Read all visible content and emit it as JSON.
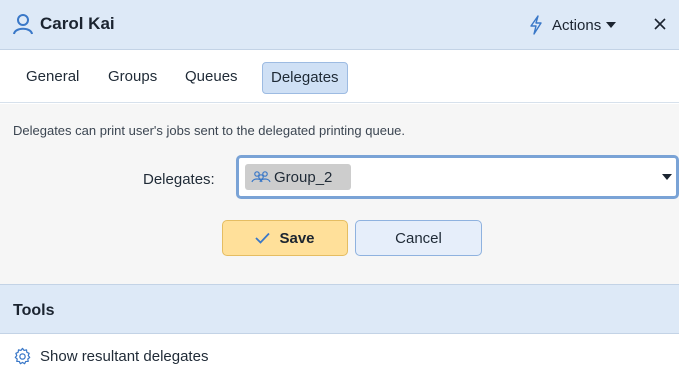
{
  "header": {
    "title": "Carol Kai",
    "actions_label": "Actions"
  },
  "tabs": [
    {
      "label": "General",
      "active": false
    },
    {
      "label": "Groups",
      "active": false
    },
    {
      "label": "Queues",
      "active": false
    },
    {
      "label": "Delegates",
      "active": true
    }
  ],
  "delegates": {
    "description": "Delegates can print user's jobs sent to the delegated printing queue.",
    "field_label": "Delegates:",
    "selected_value": "Group_2"
  },
  "buttons": {
    "save_label": "Save",
    "cancel_label": "Cancel"
  },
  "tools": {
    "heading": "Tools",
    "items": [
      {
        "label": "Show resultant delegates",
        "icon": "gear-icon"
      }
    ]
  },
  "colors": {
    "accent": "#5b8fd0",
    "header_bg": "#dde9f7",
    "save_bg": "#ffe09a",
    "active_tab_bg": "#cfe0f5"
  }
}
